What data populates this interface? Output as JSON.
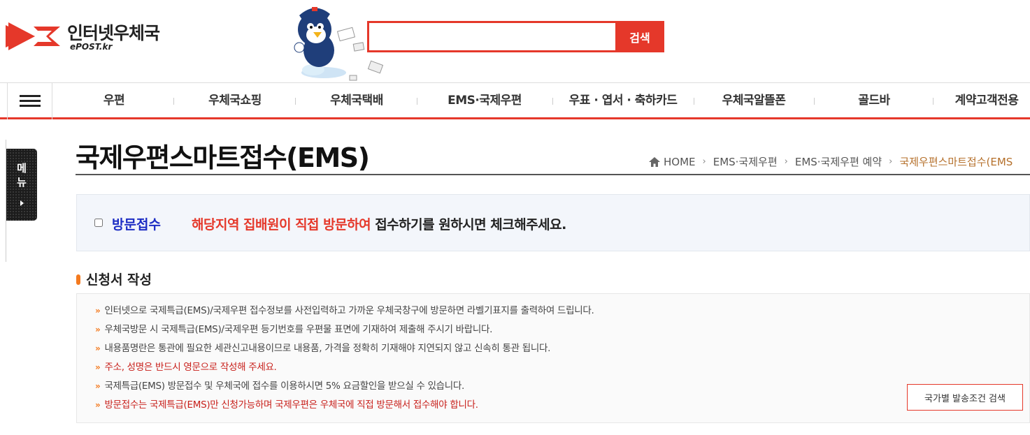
{
  "header": {
    "logo_text": "인터넷우체국",
    "logo_sub": "ePOST.kr",
    "search": {
      "placeholder": "",
      "value": "",
      "button_label": "검색"
    }
  },
  "nav": {
    "items": [
      "우편",
      "우체국쇼핑",
      "우체국택배",
      "EMS·국제우편",
      "우표 · 엽서 · 축하카드",
      "우체국알뜰폰",
      "골드바",
      "계약고객전용"
    ]
  },
  "side_menu": {
    "label": "메\n뉴"
  },
  "page": {
    "title": "국제우편스마트접수(EMS)",
    "breadcrumb": [
      "HOME",
      "EMS·국제우편",
      "EMS·국제우편 예약",
      "국제우편스마트접수(EMS"
    ]
  },
  "visit": {
    "label": "방문접수",
    "message_red": "해당지역 집배원이 직접 방문하여",
    "message_rest": " 접수하기를 원하시면 체크해주세요.",
    "checked": false
  },
  "section": {
    "title": "신청서 작성",
    "items": [
      {
        "text": "인터넷으로 국제특급(EMS)/국제우편 접수정보를 사전입력하고 가까운 우체국창구에 방문하면 라벨기표지를 출력하여 드립니다.",
        "highlight": false
      },
      {
        "text": "우체국방문 시 국제특급(EMS)/국제우편 등기번호를 우편물 표면에 기재하여 제출해 주시기 바랍니다.",
        "highlight": false
      },
      {
        "text": "내용품명란은 통관에 필요한 세관신고내용이므로 내용품, 가격을 정확히 기재해야 지연되지 않고 신속히 통관 됩니다.",
        "highlight": false
      },
      {
        "text": "주소, 성명은 반드시 영문으로 작성해 주세요.",
        "highlight": true
      },
      {
        "text": "국제특급(EMS) 방문접수 및 우체국에 접수를 이용하시면 5% 요금할인을 받으실 수 있습니다.",
        "highlight": false
      },
      {
        "text": "방문접수는 국제특급(EMS)만 신청가능하며 국제우편은 우체국에 직접 방문해서 접수해야 합니다.",
        "highlight": true
      }
    ],
    "country_button": "국가별 발송조건 검색"
  },
  "colors": {
    "accent": "#e5382a",
    "visit_label": "#1d2dc4",
    "bullet": "#f47a1f",
    "highlight_text": "#c8201b"
  }
}
